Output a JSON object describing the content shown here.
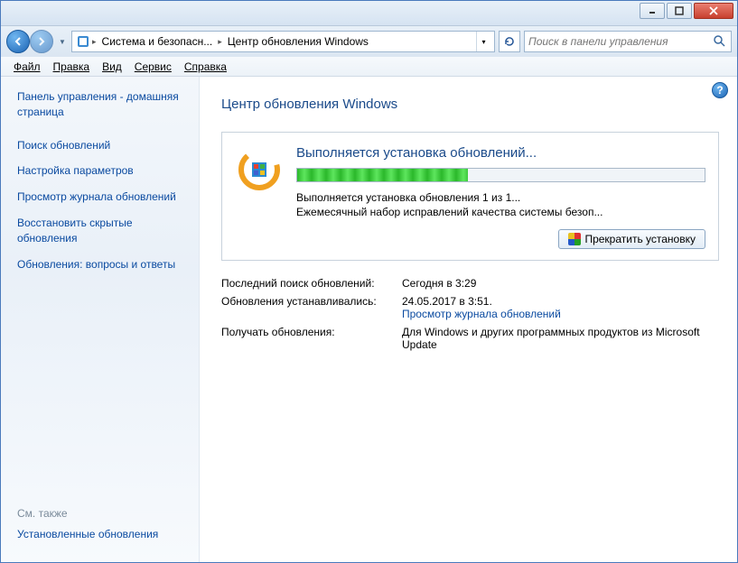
{
  "titlebar": {},
  "breadcrumb": {
    "seg1": "Система и безопасн...",
    "seg2": "Центр обновления Windows"
  },
  "search": {
    "placeholder": "Поиск в панели управления"
  },
  "menu": {
    "file": "Файл",
    "edit": "Правка",
    "view": "Вид",
    "tools": "Сервис",
    "help": "Справка"
  },
  "sidebar": {
    "home": "Панель управления - домашняя страница",
    "check": "Поиск обновлений",
    "settings": "Настройка параметров",
    "history": "Просмотр журнала обновлений",
    "restore": "Восстановить скрытые обновления",
    "faq": "Обновления: вопросы и ответы",
    "see_also": "См. также",
    "installed": "Установленные обновления"
  },
  "main": {
    "title": "Центр обновления Windows",
    "install_title": "Выполняется установка обновлений...",
    "install_line1": "Выполняется установка обновления 1 из 1...",
    "install_line2": "Ежемесячный набор исправлений качества системы безоп...",
    "stop_button": "Прекратить установку",
    "info": {
      "last_check_label": "Последний поиск обновлений:",
      "last_check_value": "Сегодня в 3:29",
      "last_install_label": "Обновления устанавливались:",
      "last_install_value": "24.05.2017 в 3:51.",
      "history_link": "Просмотр журнала обновлений",
      "receive_label": "Получать обновления:",
      "receive_value": "Для Windows и других программных продуктов из Microsoft Update"
    }
  }
}
